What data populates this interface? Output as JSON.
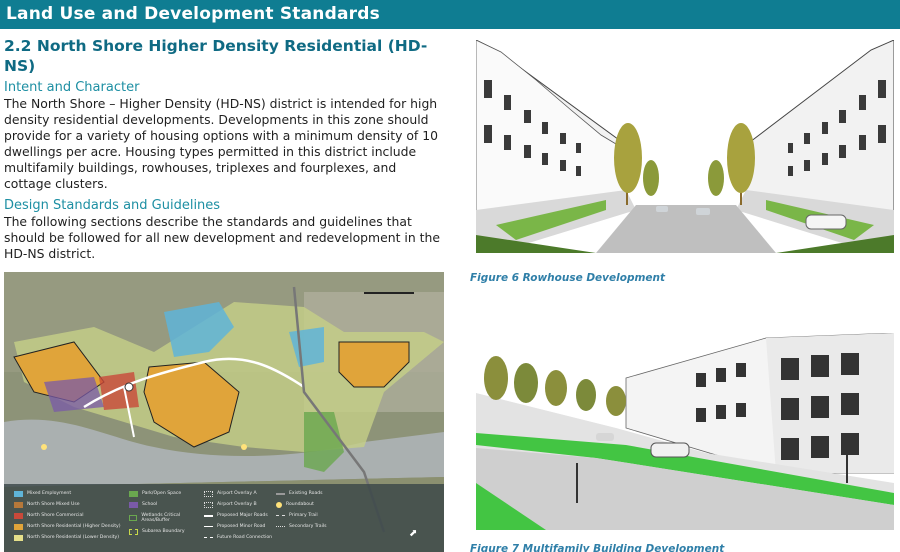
{
  "banner": {
    "title": "Land Use and Development Standards"
  },
  "section": {
    "title": "2.2 North Shore Higher Density Residential (HD-NS)",
    "intent_heading": "Intent and Character",
    "intent_lines": [
      "The North Shore – Higher Density (HD-NS) district is intended for high",
      "density residential developments. Developments in this zone should",
      "provide for a variety of housing options with a minimum density of 10",
      "dwellings per acre. Housing types permitted in this district include",
      "multifamily buildings, rowhouses, triplexes and fourplexes, and",
      "cottage clusters."
    ],
    "design_heading": "Design Standards and Guidelines",
    "design_lines": [
      "The following sections describe the standards and guidelines that",
      "should be followed for all new development and redevelopment in the",
      "HD-NS district."
    ]
  },
  "map_legend": {
    "col1": [
      "Mixed Employment",
      "North Shore Mixed Use",
      "North Shore Commercial",
      "North Shore Residential (Higher Density)",
      "North Shore Residential (Lower Density)"
    ],
    "col2": [
      "Park/Open Space",
      "School",
      "Wetlands Critical Areas/Buffer",
      "Subarea Boundary"
    ],
    "col3": [
      "Airport Overlay A",
      "Airport Overlay B",
      "Proposed Major Roads",
      "Proposed Minor Road",
      "Future Road Connection"
    ],
    "col4": [
      "Existing Roads",
      "Roundabout",
      "Primary Trail",
      "Secondary Trails"
    ],
    "colors": {
      "mixed_employment": "#5fb4d8",
      "mixed_use": "#b6783a",
      "commercial": "#c9493a",
      "higher_density": "#e0a43a",
      "lower_density": "#e5df8a",
      "park": "#6aa84f",
      "school": "#7a5aa8"
    }
  },
  "figures": {
    "fig6_caption": "Figure 6 Rowhouse Development",
    "fig7_caption": "Figure 7 Multifamily Building Development"
  }
}
